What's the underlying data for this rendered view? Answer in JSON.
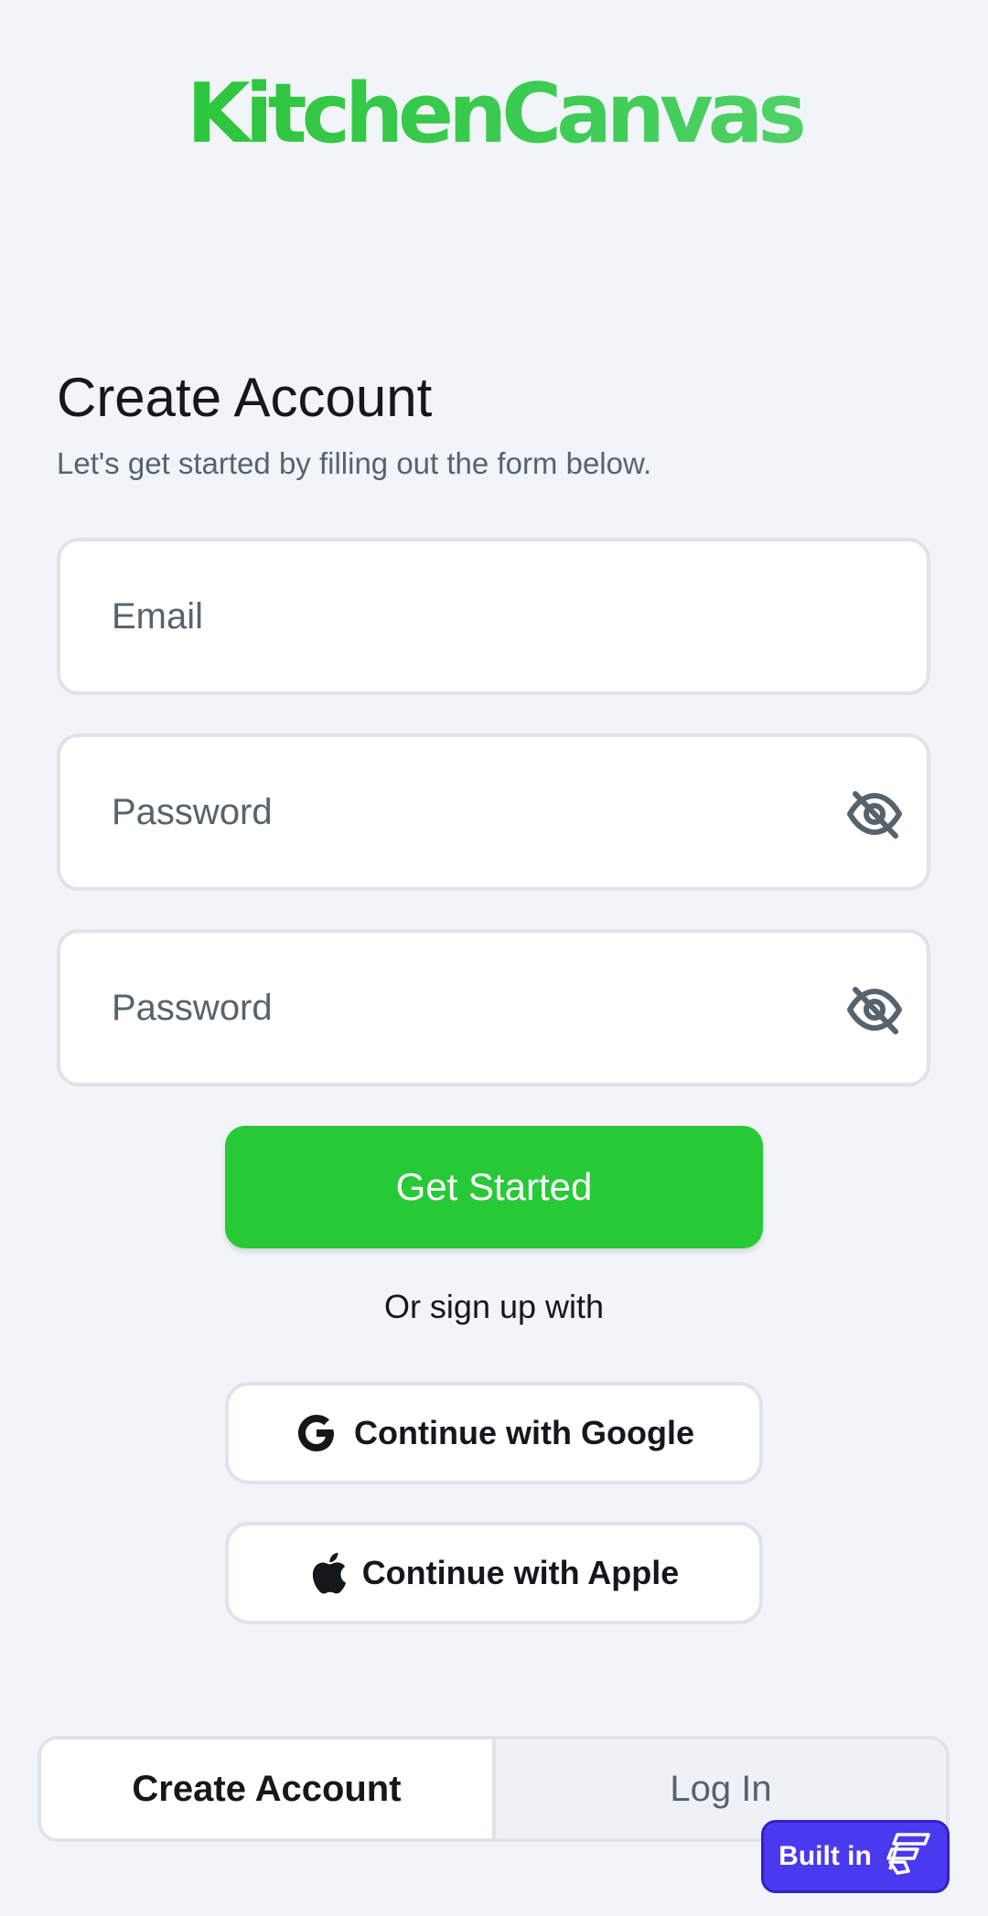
{
  "app": {
    "logo": "KitchenCanvas",
    "brand_color": "#28c936"
  },
  "header": {
    "title": "Create Account",
    "subtitle": "Let's get started by filling out the form below."
  },
  "form": {
    "email": {
      "placeholder": "Email",
      "value": ""
    },
    "password": {
      "placeholder": "Password",
      "value": "",
      "icon": "eye-off-icon"
    },
    "confirm_password": {
      "placeholder": "Password",
      "value": "",
      "icon": "eye-off-icon"
    },
    "submit_label": "Get Started"
  },
  "social": {
    "divider_text": "Or sign up with",
    "google_label": "Continue with Google",
    "apple_label": "Continue with Apple"
  },
  "tabs": [
    {
      "label": "Create Account",
      "active": true
    },
    {
      "label": "Log In",
      "active": false
    }
  ],
  "badge": {
    "label": "Built in",
    "color": "#4b39ef"
  }
}
